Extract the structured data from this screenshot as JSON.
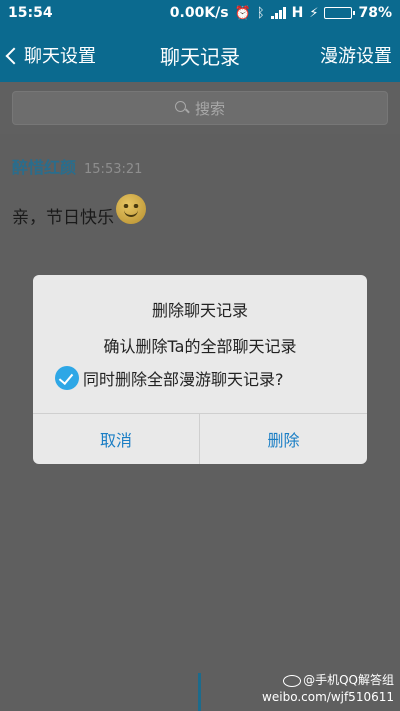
{
  "status_bar": {
    "time": "15:54",
    "speed": "0.00K/s",
    "network": "H",
    "battery": "78%",
    "battery_level": 0.78
  },
  "nav": {
    "back_label": "聊天设置",
    "title": "聊天记录",
    "right_label": "漫游设置"
  },
  "search": {
    "placeholder": "搜索"
  },
  "message": {
    "sender": "醉惜红颜",
    "time": "15:53:21",
    "text": "亲，节日快乐"
  },
  "dialog": {
    "title": "删除聊天记录",
    "message": "确认删除Ta的全部聊天记录",
    "option_label": "同时删除全部漫游聊天记录?",
    "option_checked": true,
    "cancel_label": "取消",
    "delete_label": "删除"
  },
  "watermark": {
    "line1": "@手机QQ解答组",
    "line2": "weibo.com/wjf510611"
  },
  "colors": {
    "accent": "#0b6a8f",
    "button_text": "#1a7ec5",
    "check": "#2ea7e6"
  }
}
